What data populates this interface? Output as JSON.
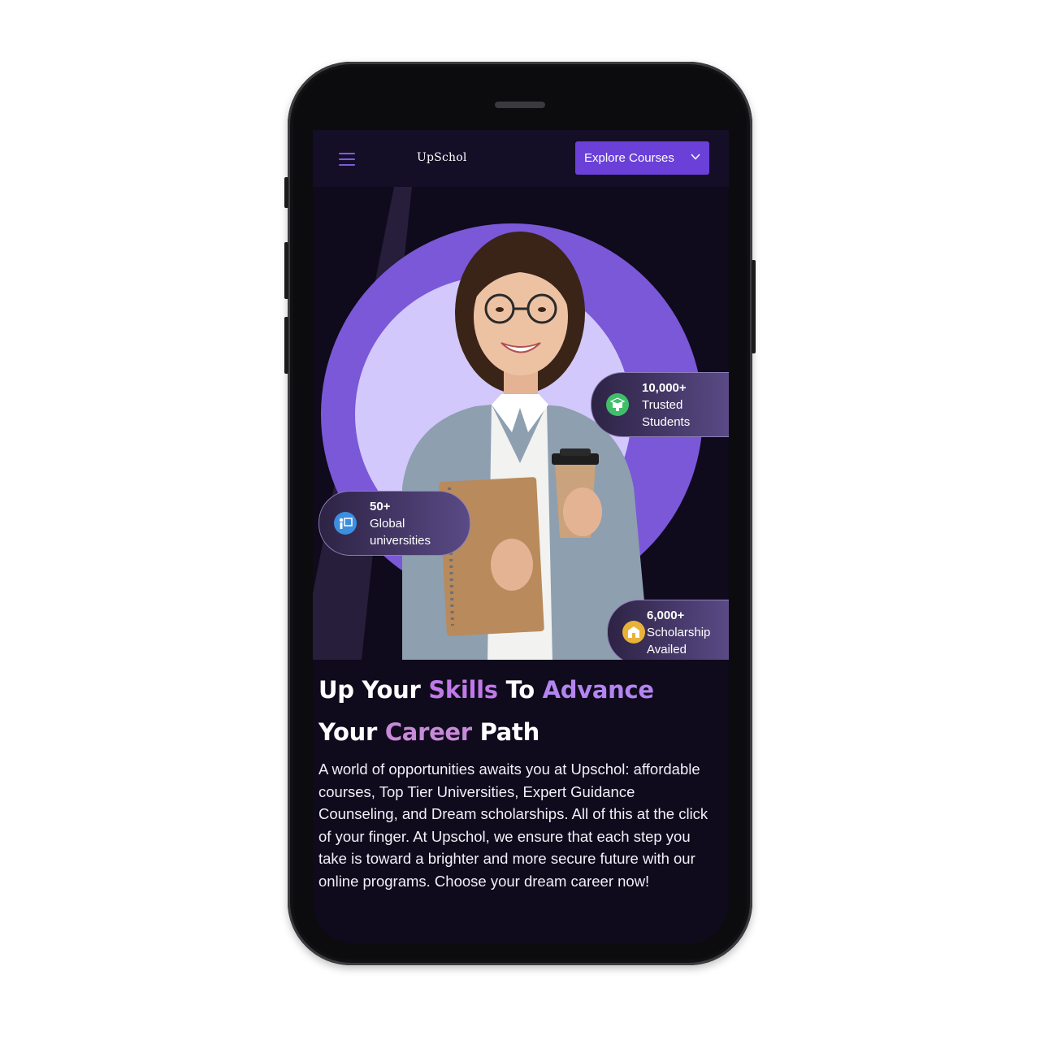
{
  "app": {
    "logo_text": "UpSchol"
  },
  "nav": {
    "explore_label": "Explore Courses"
  },
  "badges": {
    "students": {
      "number": "10,000+",
      "line1": "Trusted",
      "line2": "Students",
      "icon": "graduation-icon",
      "color": "#3fbf6a"
    },
    "universities": {
      "number": "50+",
      "line1": "Global",
      "line2": "universities",
      "icon": "presentation-icon",
      "color": "#3b8ee0"
    },
    "scholarship": {
      "number": "6,000+",
      "line1": "Scholarship",
      "line2": "Availed",
      "icon": "school-icon",
      "color": "#e8b23a"
    }
  },
  "hero": {
    "headline": {
      "w1": "Up Your ",
      "w2": "Skills",
      "w3": " To ",
      "w4": "Advance",
      "w5": "Your ",
      "w6": "Career",
      "w7": " Path"
    },
    "description": "A world of opportunities awaits you at Upschol: affordable courses, Top Tier Universities, Expert Guidance Counseling, and Dream scholarships. All of this at the click of your finger. At Upschol, we ensure that each step you take is toward a brighter and more secure future with our online programs. Choose your dream career now!"
  },
  "colors": {
    "accent": "#6a40d8",
    "background": "#0f0a1c",
    "circle": "#7a58d8",
    "circle_inner": "#d2c8fb"
  }
}
